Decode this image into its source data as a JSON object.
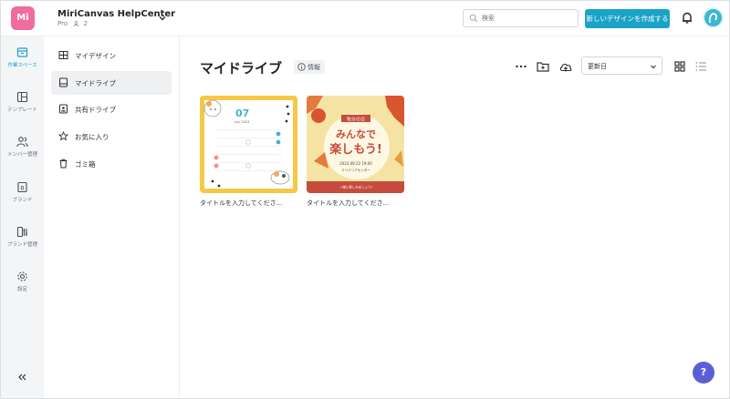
{
  "header": {
    "logo_text": "Mi",
    "workspace_name": "MiriCanvas HelpCenter",
    "workspace_plan": "Pro",
    "member_count": "2",
    "search_placeholder": "検索",
    "create_button": "新しいデザインを作成する"
  },
  "rail": {
    "items": [
      {
        "label": "作業スペース",
        "icon": "workspace-icon",
        "active": true
      },
      {
        "label": "テンプレート",
        "icon": "template-icon",
        "active": false
      },
      {
        "label": "メンバー管理",
        "icon": "members-icon",
        "active": false
      },
      {
        "label": "ブランド",
        "icon": "brand-icon",
        "active": false
      },
      {
        "label": "ブランド管理",
        "icon": "brand-manage-icon",
        "active": false
      },
      {
        "label": "設定",
        "icon": "settings-icon",
        "active": false
      }
    ],
    "collapse": "«"
  },
  "subnav": {
    "items": [
      {
        "label": "マイデザイン",
        "icon": "my-design-icon",
        "active": false
      },
      {
        "label": "マイドライブ",
        "icon": "my-drive-icon",
        "active": true
      },
      {
        "label": "共有ドライブ",
        "icon": "shared-drive-icon",
        "active": false
      },
      {
        "label": "お気に入り",
        "icon": "star-icon",
        "active": false
      },
      {
        "label": "ゴミ箱",
        "icon": "trash-icon",
        "active": false
      }
    ]
  },
  "main": {
    "title": "マイドライブ",
    "info_label": "情報",
    "sort_value": "更新日",
    "cards": [
      {
        "title": "タイトルを入力してくださ...",
        "thumb_month": "07",
        "thumb_month_sub": "July 2023"
      },
      {
        "title": "タイトルを入力してくださ...",
        "thumb_badge": "秋分の日",
        "thumb_line1": "みんなで",
        "thumb_line2": "楽しもう!",
        "thumb_date": "2023.09.22 19:00",
        "thumb_place": "ミリミリアセンター",
        "thumb_footer": "一緒に楽しみましょう!"
      }
    ]
  },
  "help_label": "?",
  "colors": {
    "accent": "#1aa3c7",
    "logo": "#ef6c9f",
    "help": "#5b5fd6",
    "card1_frame": "#f6c846",
    "card2_bg": "#f5e3a3",
    "card2_bottom": "#c64b3c"
  }
}
